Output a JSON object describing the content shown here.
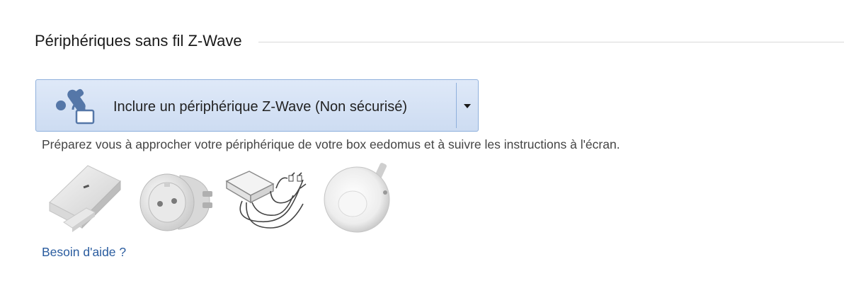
{
  "section": {
    "title": "Périphériques sans fil Z-Wave"
  },
  "include_button": {
    "label": "Inclure un périphérique Z-Wave (Non sécurisé)",
    "icon": "zwave-include-lock-icon"
  },
  "instructions": "Préparez vous à approcher votre périphérique de votre box eedomus et à suivre les instructions à l'écran.",
  "devices": [
    {
      "name": "door-window-sensor"
    },
    {
      "name": "smart-plug"
    },
    {
      "name": "relay-module"
    },
    {
      "name": "motion-sensor"
    }
  ],
  "help_link": "Besoin d'aide ?",
  "colors": {
    "button_border": "#8fb0dc",
    "button_bg": "#d6e2f5",
    "icon_blue": "#5577a8",
    "link": "#2a5c9f"
  }
}
